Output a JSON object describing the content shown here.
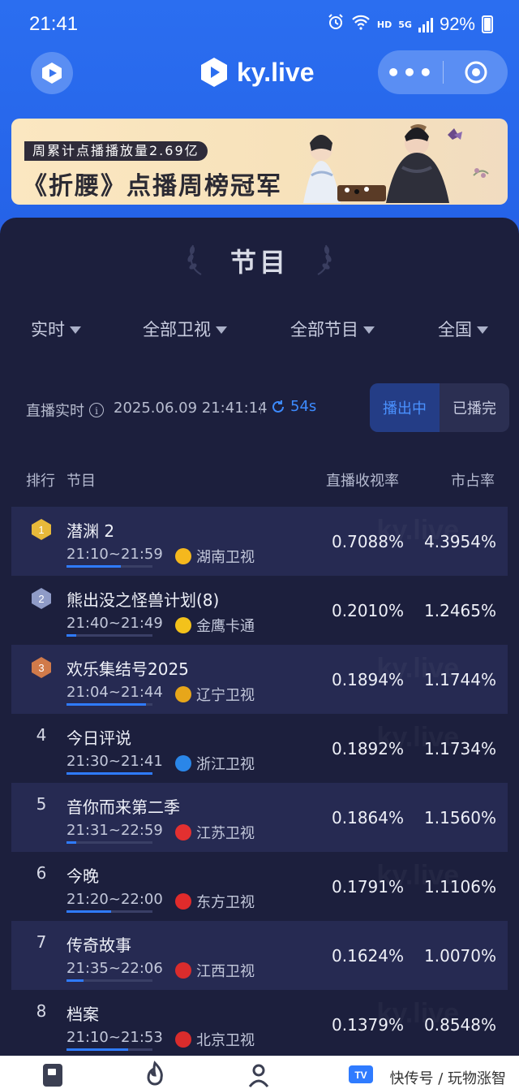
{
  "status_bar": {
    "time": "21:41",
    "network_tag": "HD",
    "network_gen": "5G",
    "battery": "92%"
  },
  "header": {
    "app_name": "ky.live",
    "more_label": "•••"
  },
  "banner": {
    "tag": "周累计点播播放量2.69亿",
    "title": "《折腰》点播周榜冠军"
  },
  "panel": {
    "title": "节目",
    "filters": [
      {
        "label": "实时"
      },
      {
        "label": "全部卫视"
      },
      {
        "label": "全部节目"
      },
      {
        "label": "全国"
      }
    ],
    "live_label": "直播实时",
    "live_timestamp": "2025.06.09 21:41:14",
    "refresh_countdown": "54s",
    "toggle": {
      "on_air": "播出中",
      "finished": "已播完"
    },
    "columns": {
      "rank": "排行",
      "program": "节目",
      "rating": "直播收视率",
      "share": "市占率"
    }
  },
  "rows": [
    {
      "rank": "1",
      "name": "潜渊 2",
      "time": "21:10~21:59",
      "channel": "湖南卫视",
      "rating": "0.7088%",
      "share": "4.3954%",
      "progress": 0.63,
      "badge": "gold",
      "channel_color": "#f5b81d"
    },
    {
      "rank": "2",
      "name": "熊出没之怪兽计划(8)",
      "time": "21:40~21:49",
      "channel": "金鹰卡通",
      "rating": "0.2010%",
      "share": "1.2465%",
      "progress": 0.11,
      "badge": "silver",
      "channel_color": "#f3c21b"
    },
    {
      "rank": "3",
      "name": "欢乐集结号2025",
      "time": "21:04~21:44",
      "channel": "辽宁卫视",
      "rating": "0.1894%",
      "share": "1.1744%",
      "progress": 0.92,
      "badge": "bronze",
      "channel_color": "#e7a61a"
    },
    {
      "rank": "4",
      "name": "今日评说",
      "time": "21:30~21:41",
      "channel": "浙江卫视",
      "rating": "0.1892%",
      "share": "1.1734%",
      "progress": 1.0,
      "badge": "",
      "channel_color": "#2a86e8"
    },
    {
      "rank": "5",
      "name": "音你而来第二季",
      "time": "21:31~22:59",
      "channel": "江苏卫视",
      "rating": "0.1864%",
      "share": "1.1560%",
      "progress": 0.11,
      "badge": "",
      "channel_color": "#e33030"
    },
    {
      "rank": "6",
      "name": "今晚",
      "time": "21:20~22:00",
      "channel": "东方卫视",
      "rating": "0.1791%",
      "share": "1.1106%",
      "progress": 0.52,
      "badge": "",
      "channel_color": "#e02b2b"
    },
    {
      "rank": "7",
      "name": "传奇故事",
      "time": "21:35~22:06",
      "channel": "江西卫视",
      "rating": "0.1624%",
      "share": "1.0070%",
      "progress": 0.2,
      "badge": "",
      "channel_color": "#d92c2c"
    },
    {
      "rank": "8",
      "name": "档案",
      "time": "21:10~21:53",
      "channel": "北京卫视",
      "rating": "0.1379%",
      "share": "0.8548%",
      "progress": 0.72,
      "badge": "",
      "channel_color": "#d92c2c"
    }
  ],
  "footer": {
    "credit": "快传号 / 玩物涨智"
  }
}
